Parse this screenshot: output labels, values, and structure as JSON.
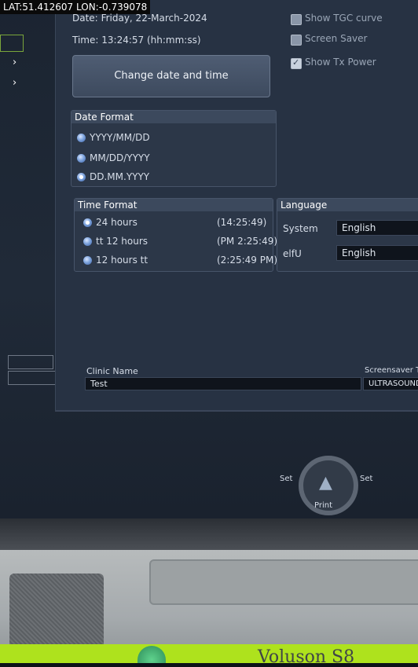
{
  "overlay": {
    "gps": "LAT:51.412607 LON:-0.739078"
  },
  "datetime": {
    "date_label": "Date:",
    "date_value": "Friday, 22-March-2024",
    "time_label": "Time:",
    "time_value": "13:24:57 (hh:mm:ss)",
    "change_button": "Change date and time"
  },
  "options": [
    {
      "label": "Show TGC curve",
      "checked": false
    },
    {
      "label": "Screen Saver",
      "checked": false
    },
    {
      "label": "Show Tx Power",
      "checked": true
    }
  ],
  "date_format": {
    "title": "Date Format",
    "items": [
      {
        "label": "YYYY/MM/DD",
        "selected": false
      },
      {
        "label": "MM/DD/YYYY",
        "selected": false
      },
      {
        "label": "DD.MM.YYYY",
        "selected": true
      }
    ]
  },
  "time_format": {
    "title": "Time Format",
    "items": [
      {
        "label": "24 hours",
        "example": "(14:25:49)",
        "selected": true
      },
      {
        "label": "tt 12 hours",
        "example": "(PM 2:25:49)",
        "selected": false
      },
      {
        "label": "12 hours tt",
        "example": "(2:25:49 PM)",
        "selected": false
      }
    ]
  },
  "language": {
    "title": "Language",
    "system_label": "System",
    "system_value": "English",
    "elfu_label": "elfU",
    "elfu_value": "English"
  },
  "clinic": {
    "label": "Clinic Name",
    "value": "Test"
  },
  "screensaver": {
    "label": "Screensaver Tex",
    "value": "ULTRASOUND"
  },
  "controls": {
    "set_left": "Set",
    "set_right": "Set",
    "print": "Print"
  },
  "device": {
    "brand": "Voluson S8"
  },
  "colors": {
    "accent_green": "#aee21d",
    "panel": "#273243"
  }
}
